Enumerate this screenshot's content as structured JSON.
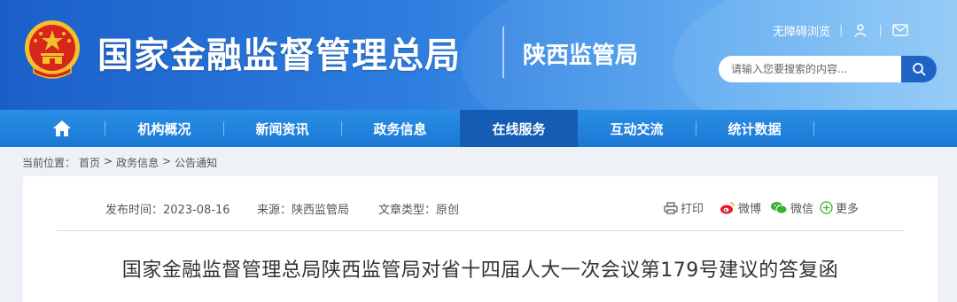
{
  "header": {
    "org_name": "国家金融监督管理总局",
    "branch_name": "陕西监管局",
    "accessible_label": "无障碍浏览",
    "separator": "|",
    "user_icon": "user-icon",
    "mail_icon": "mail-icon",
    "search": {
      "placeholder": "请输入您要搜索的内容...",
      "button_icon": "search-icon"
    }
  },
  "nav": {
    "home_icon": "home-icon",
    "items": [
      {
        "label": "机构概况"
      },
      {
        "label": "新闻资讯"
      },
      {
        "label": "政务信息"
      },
      {
        "label": "在线服务",
        "active": true
      },
      {
        "label": "互动交流"
      },
      {
        "label": "统计数据"
      }
    ]
  },
  "breadcrumb": {
    "prefix": "当前位置：",
    "items": [
      "首页",
      "政务信息",
      "公告通知"
    ],
    "separator": ">"
  },
  "article": {
    "publish_time": "发布时间：2023-08-16",
    "source": "来源：陕西监管局",
    "type": "文章类型：原创",
    "share": {
      "print": "打印",
      "weibo": "微博",
      "wechat": "微信",
      "more": "更多"
    },
    "title": "国家金融监督管理总局陕西监管局对省十四届人大一次会议第179号建议的答复函"
  },
  "colors": {
    "header_start": "#1a5fc8",
    "header_end": "#86c6f7",
    "nav_bg": "#1b78d4",
    "nav_active": "#155cb4",
    "emblem_red": "#d8261c",
    "emblem_gold": "#f4c02c"
  }
}
